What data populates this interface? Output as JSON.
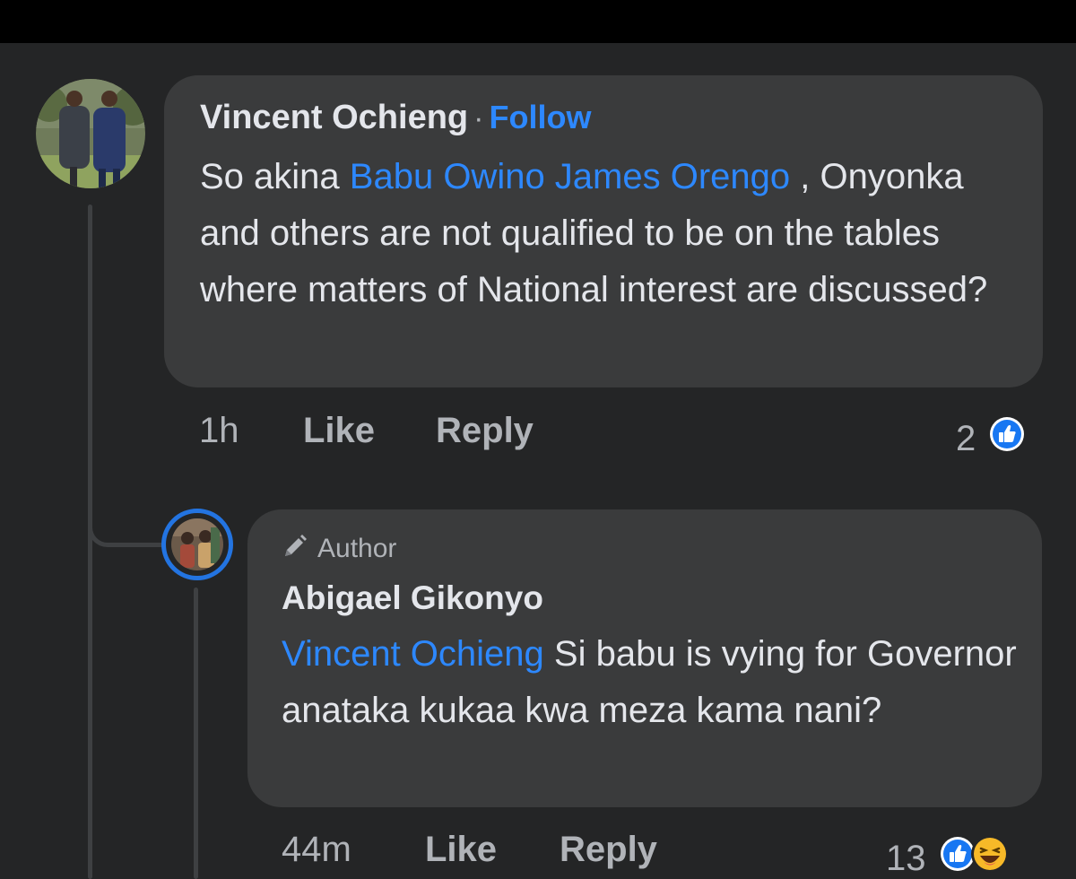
{
  "comment": {
    "author": "Vincent Ochieng",
    "separator": "·",
    "follow_label": "Follow",
    "text_before": "So akina ",
    "mention": "Babu Owino James Orengo",
    "text_after": " , Onyonka and others are not qualified to be on the tables where matters of National interest are discussed?",
    "time": "1h",
    "like_label": "Like",
    "reply_label": "Reply",
    "reaction_count": "2",
    "reactions": [
      "like-icon"
    ]
  },
  "reply": {
    "badge_label": "Author",
    "author": "Abigael Gikonyo",
    "mention": "Vincent Ochieng",
    "text": " Si babu is vying for Governor anataka kukaa kwa meza kama nani?",
    "time": "44m",
    "like_label": "Like",
    "reply_label": "Reply",
    "reaction_count": "13",
    "reactions": [
      "like-icon",
      "haha-icon"
    ]
  },
  "colors": {
    "background": "#242526",
    "bubble": "#3a3b3c",
    "link": "#2d88ff",
    "text": "#e4e6eb",
    "muted": "#b0b3b8",
    "avatar_ring": "#2374e1"
  }
}
